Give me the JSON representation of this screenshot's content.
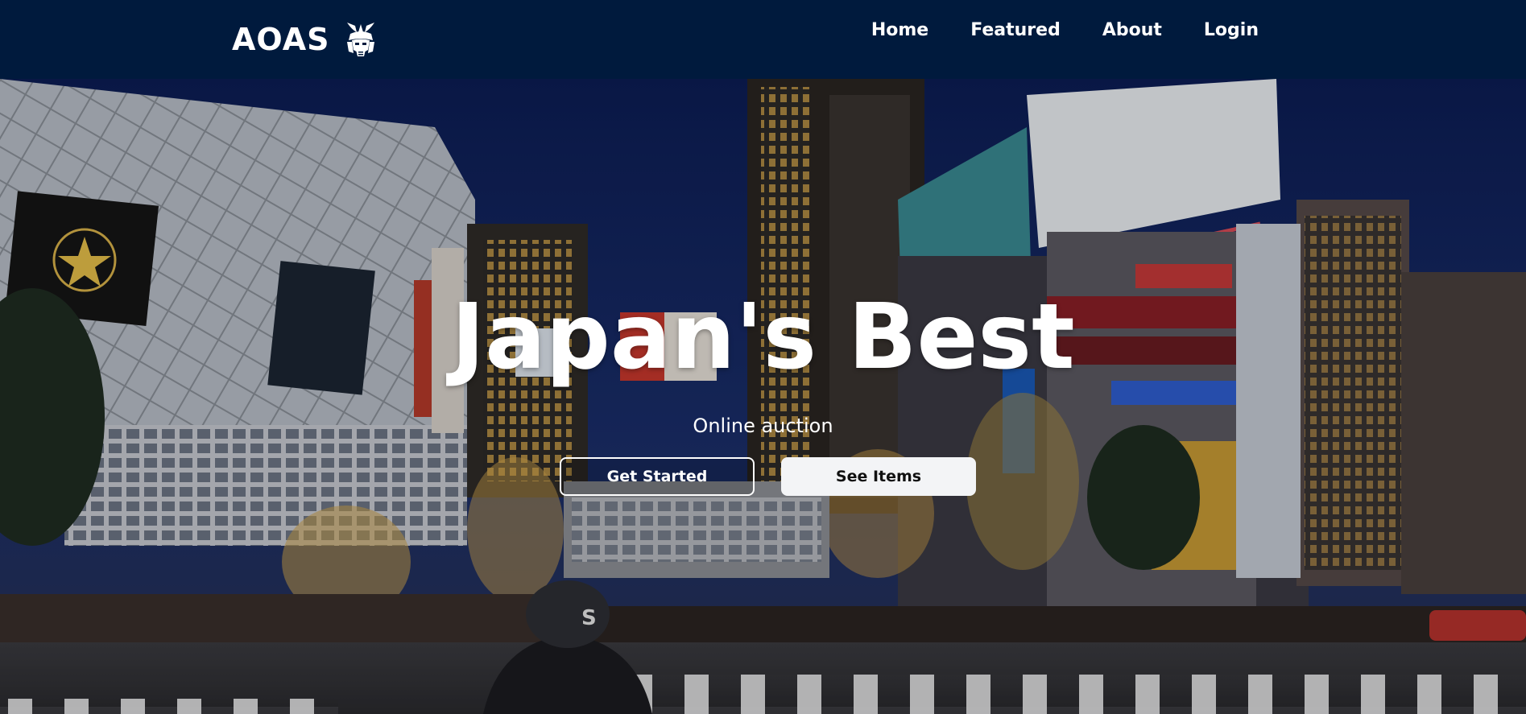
{
  "navbar": {
    "brand": "AOAS",
    "brand_logo_icon": "samurai-helmet-icon",
    "links": [
      {
        "label": "Home"
      },
      {
        "label": "Featured"
      },
      {
        "label": "About"
      },
      {
        "label": "Login"
      }
    ]
  },
  "hero": {
    "title": "Japan's Best",
    "subtitle": "Online auction",
    "primary_button": "Get Started",
    "secondary_button": "See Items",
    "background_image": "shibuya-crossing-night-photo"
  },
  "colors": {
    "navbar_bg": "#001a3d",
    "text": "#ffffff",
    "button_solid_bg": "#f3f4f6"
  }
}
